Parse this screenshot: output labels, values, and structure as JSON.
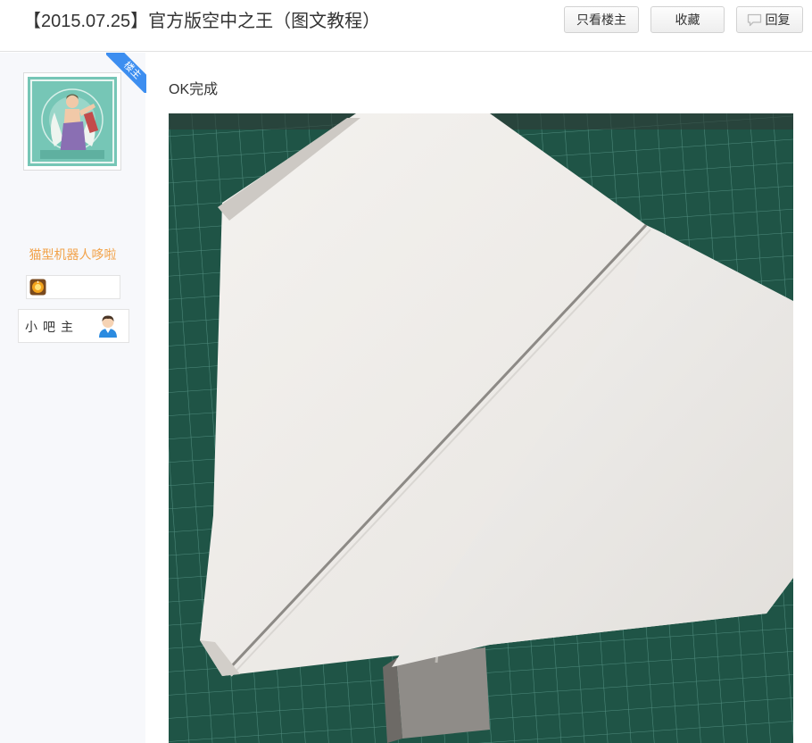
{
  "thread": {
    "title": "【2015.07.25】官方版空中之王（图文教程）"
  },
  "toolbar": {
    "only_owner_label": "只看楼主",
    "favorite_label": "收藏",
    "reply_label": "回复"
  },
  "author": {
    "owner_tag": "楼主",
    "username": "猫型机器人哆啦",
    "role": "小吧主"
  },
  "post": {
    "text": "OK完成"
  },
  "colors": {
    "username": "#f2a249",
    "owner_ribbon": "#3d8ef0",
    "sidebar_bg": "#f7f8fb",
    "cutting_mat": "#1f5446"
  },
  "icons": {
    "reply": "speech-bubble-icon",
    "badge": "level-badge-icon",
    "role": "user-avatar-icon"
  }
}
